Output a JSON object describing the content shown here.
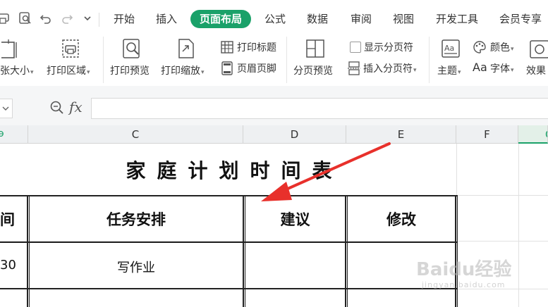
{
  "tabs": [
    {
      "label": "开始",
      "active": false
    },
    {
      "label": "插入",
      "active": false
    },
    {
      "label": "页面布局",
      "active": true
    },
    {
      "label": "公式",
      "active": false
    },
    {
      "label": "数据",
      "active": false
    },
    {
      "label": "审阅",
      "active": false
    },
    {
      "label": "视图",
      "active": false
    },
    {
      "label": "开发工具",
      "active": false
    },
    {
      "label": "会员专享",
      "active": false
    }
  ],
  "ribbon": {
    "paper_size": "张大小",
    "print_area": "打印区域",
    "print_preview": "打印预览",
    "print_scale": "打印缩放",
    "print_titles": "打印标题",
    "header_footer": "页眉页脚",
    "page_break_preview": "分页预览",
    "show_page_breaks": "显示分页符",
    "insert_page_break": "插入分页符",
    "theme": "主题",
    "colors": "颜色",
    "fonts_icon_text": "Aa",
    "fonts": "字体",
    "effects": "效果"
  },
  "formula_bar": {
    "fx_label": "fx",
    "value": ""
  },
  "columns": [
    "C",
    "D",
    "E",
    "F",
    "G"
  ],
  "sheet": {
    "title": "家庭计划时间表",
    "headers": [
      "间",
      "任务安排",
      "建议",
      "修改"
    ],
    "rows": [
      [
        "30",
        "写作业",
        "",
        ""
      ]
    ]
  },
  "watermark": {
    "text": "Baidu经验",
    "url": "jingyan.baidu.com"
  },
  "colors": {
    "accent": "#1aa169",
    "arrow": "#e8302b"
  }
}
